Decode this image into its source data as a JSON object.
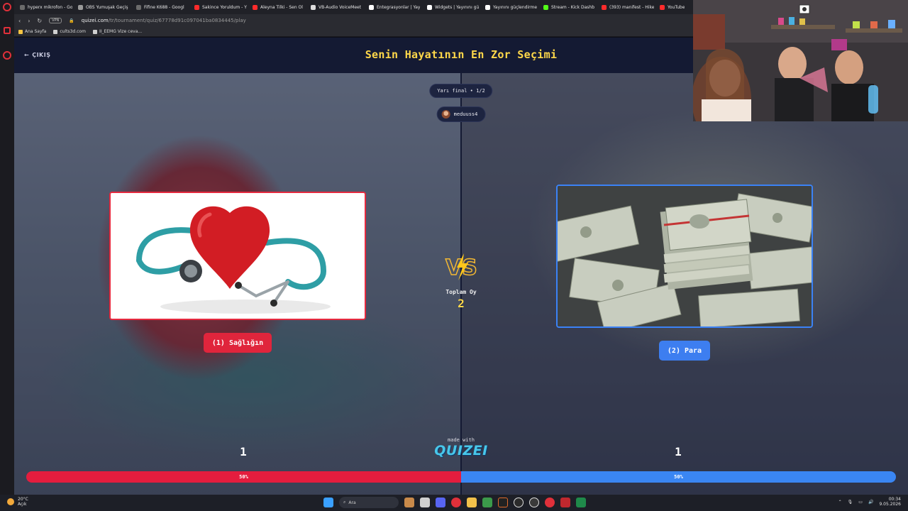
{
  "browser": {
    "tabs": [
      {
        "label": "hyperx mikrofon - Go",
        "color": "#6b6b6b"
      },
      {
        "label": "OBS Yumuşak Geçiş",
        "color": "#9a9a9a"
      },
      {
        "label": "Fifine K688 - Googl",
        "color": "#6b6b6b"
      },
      {
        "label": "Sakince Yoruldum - Y",
        "color": "#ff2b2b"
      },
      {
        "label": "Aleyna Tilki - Sen Ol",
        "color": "#ff2b2b"
      },
      {
        "label": "VB-Audio VoiceMeet",
        "color": "#dddddd"
      },
      {
        "label": "Entegrasyonlar | Yay",
        "color": "#ffffff"
      },
      {
        "label": "Widgets | Yayınını gü",
        "color": "#ffffff"
      },
      {
        "label": "Yayınını güçlendirme",
        "color": "#ffffff"
      },
      {
        "label": "Stream - Kick Dashb",
        "color": "#53fc18"
      },
      {
        "label": "(393) manifest - Hike",
        "color": "#ff2b2b"
      },
      {
        "label": "YouTube",
        "color": "#ff2b2b"
      }
    ],
    "url_host": "quizei.com",
    "url_path": "/tr/tournament/quiz/67778d91c097041ba0834445/play",
    "vpn_label": "VPN",
    "bookmarks": [
      "Ana Sayfa",
      "cults3d.com",
      "II_EEMG Vize ceva..."
    ]
  },
  "quiz": {
    "exit_label": "ÇIKIŞ",
    "title": "Senin Hayatının En Zor Seçimi",
    "round": "Yarı final • 1/2",
    "user": "meduuss4",
    "total_label": "Toplam Oy",
    "total_votes": "2",
    "left": {
      "label": "(1) Sağlığın",
      "votes": "1",
      "percent": "50%",
      "share": 0.5,
      "color": "#e41d3e"
    },
    "right": {
      "label": "(2) Para",
      "votes": "1",
      "percent": "50%",
      "share": 0.5,
      "color": "#3a86f3"
    },
    "made_with": "made with",
    "brand": "QUIZEI"
  },
  "taskbar": {
    "temperature": "20°C",
    "weather": "Açık",
    "search_placeholder": "Ara",
    "time": "00:34",
    "date": "9.05.2026"
  }
}
